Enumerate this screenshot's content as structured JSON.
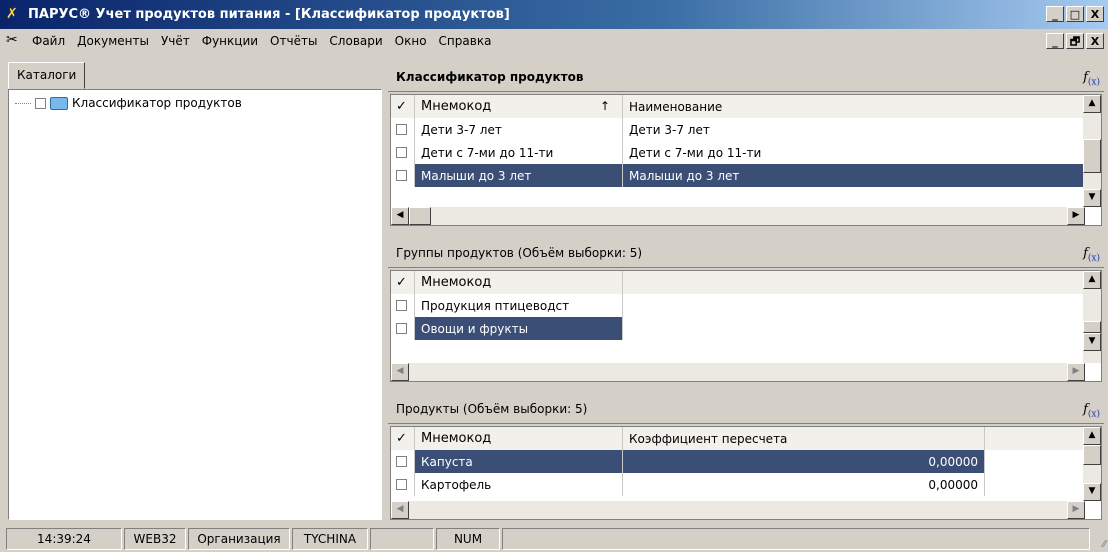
{
  "window": {
    "title": "ПАРУС® Учет продуктов питания - [Классификатор продуктов]",
    "buttons": [
      "_",
      "□",
      "X"
    ],
    "mdi_buttons": [
      "_",
      "🗗",
      "X"
    ]
  },
  "menu": {
    "items": [
      {
        "label": "Файл"
      },
      {
        "label": "Документы"
      },
      {
        "label": "Учёт"
      },
      {
        "label": "Функции"
      },
      {
        "label": "Отчёты"
      },
      {
        "label": "Словари"
      },
      {
        "label": "Окно"
      },
      {
        "label": "Справка"
      }
    ]
  },
  "left": {
    "tab_label": "Каталоги",
    "tree": [
      {
        "label": "Классификатор продуктов"
      }
    ]
  },
  "sections": {
    "classifier": {
      "title": "Классификатор продуктов",
      "fx_label": "f",
      "fx_sub": "(x)",
      "header_check": "✓",
      "sort_arrow": "↑",
      "columns": [
        "Мнемокод",
        "Наименование"
      ],
      "rows": [
        {
          "code": "Дети 3-7 лет",
          "name": "Дети 3-7 лет"
        },
        {
          "code": "Дети с 7-ми до 11-ти",
          "name": "Дети с 7-ми до 11-ти"
        },
        {
          "code": "Малыши до 3 лет",
          "name": "Малыши до 3 лет",
          "selected": true
        }
      ]
    },
    "groups": {
      "title": "Группы продуктов (Объём выборки: 5)",
      "fx_label": "f",
      "fx_sub": "(x)",
      "header_check": "✓",
      "columns": [
        "Мнемокод"
      ],
      "rows": [
        {
          "code": "Продукция птицеводст"
        },
        {
          "code": "Овощи и фрукты",
          "selected": true
        }
      ]
    },
    "products": {
      "title": "Продукты (Объём выборки: 5)",
      "fx_label": "f",
      "fx_sub": "(x)",
      "header_check": "✓",
      "columns": [
        "Мнемокод",
        "Коэффициент пересчета"
      ],
      "rows": [
        {
          "code": "Капуста",
          "coef": "0,00000",
          "selected": true
        },
        {
          "code": "Картофель",
          "coef": "0,00000"
        }
      ]
    }
  },
  "status": {
    "time": "14:39:24",
    "server": "WEB32",
    "org": "Организация",
    "user": "TYCHINA",
    "blank": "",
    "num": "NUM",
    "grip": "⁄⁄"
  },
  "icons": {
    "app": "parus-logo-icon",
    "folder": "folder-icon",
    "fx": "formula-icon"
  }
}
